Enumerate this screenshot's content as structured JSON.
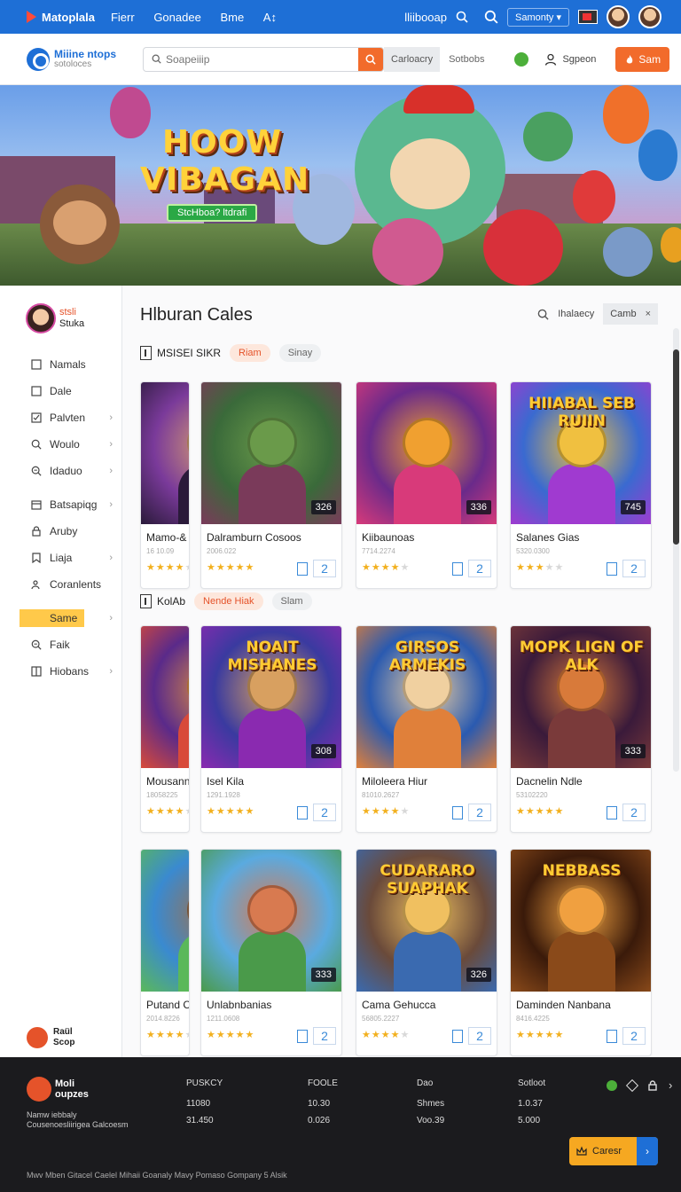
{
  "topbar": {
    "brand": "Matoplala",
    "nav": [
      "Fierr",
      "Gonadee",
      "Bme",
      "A↕"
    ],
    "account_text": "lliibooap",
    "pill_label": "Samonty"
  },
  "header": {
    "logo_line1": "Miiine ntops",
    "logo_line2": "sotoloces",
    "search_placeholder": "Soapeiiip",
    "category_button": "Carloacry",
    "link_1": "Sotbobs",
    "signin_label": "Sgpeon",
    "start_label": "Sam"
  },
  "hero": {
    "title_line1": "HOOW",
    "title_line2": "VIBAGAN",
    "cta_label": "StcHboa? ltdrafi"
  },
  "sidebar": {
    "user_name": "stsli",
    "user_sub": "Stuka",
    "items": [
      {
        "label": "Namals",
        "icon": "square-icon",
        "chevron": false
      },
      {
        "label": "Dale",
        "icon": "square-icon",
        "chevron": false
      },
      {
        "label": "Palvten",
        "icon": "check-square-icon",
        "chevron": true
      },
      {
        "label": "Woulo",
        "icon": "search-icon",
        "chevron": true
      },
      {
        "label": "Idaduo",
        "icon": "search-plus-icon",
        "chevron": true
      },
      {
        "label": "Batsapiqg",
        "icon": "calendar-icon",
        "chevron": true
      },
      {
        "label": "Aruby",
        "icon": "lock-icon",
        "chevron": false
      },
      {
        "label": "Liaja",
        "icon": "bookmark-icon",
        "chevron": true
      },
      {
        "label": "Coranlents",
        "icon": "people-icon",
        "chevron": false
      },
      {
        "label": "Same",
        "icon": "crown-icon",
        "chevron": true,
        "active": true
      },
      {
        "label": "Faik",
        "icon": "search-plus-icon",
        "chevron": false
      },
      {
        "label": "Hiobans",
        "icon": "columns-icon",
        "chevron": true
      }
    ],
    "footer_line1": "Raül",
    "footer_line2": "Scop"
  },
  "main": {
    "title": "Hlburan Cales",
    "search_label": "Ihalaecy",
    "chip_label": "Camb",
    "chip_close": "×",
    "section1": {
      "label": "MSISEI SIKR",
      "tag_on": "Riam",
      "tag_off": "Sinay"
    },
    "section2": {
      "label": "KolAb",
      "tag_on": "Nende Hiak",
      "tag_off": "Slam"
    },
    "cards": [
      {
        "title": "Mamo-&",
        "sub": "16 10.09",
        "count": "",
        "stars": 4,
        "num": "2",
        "theme": "a",
        "image_text": ""
      },
      {
        "title": "Dalramburn Cosoos",
        "sub": "2006.022",
        "count": "326",
        "stars": 5,
        "num": "2",
        "theme": "b",
        "image_text": ""
      },
      {
        "title": "Kiibaunoas",
        "sub": "7714.2274",
        "count": "336",
        "stars": 4,
        "num": "2",
        "theme": "c",
        "image_text": ""
      },
      {
        "title": "Salanes Gias",
        "sub": "5320.0300",
        "count": "745",
        "stars": 3,
        "num": "2",
        "theme": "d",
        "image_text": "HIIABAL SEB RUIIN"
      },
      {
        "title": "Mousann",
        "sub": "18058225",
        "count": "",
        "stars": 4,
        "num": "2",
        "theme": "e",
        "image_text": ""
      },
      {
        "title": "Isel Kila",
        "sub": "1291.1928",
        "count": "308",
        "stars": 5,
        "num": "2",
        "theme": "f",
        "image_text": "NOAIT MISHANES"
      },
      {
        "title": "Miloleera Hiur",
        "sub": "81010.2627",
        "count": "",
        "stars": 4,
        "num": "2",
        "theme": "g",
        "image_text": "GIRSOS ARMEKIS"
      },
      {
        "title": "Dacnelin Ndle",
        "sub": "53102220",
        "count": "333",
        "stars": 5,
        "num": "2",
        "theme": "h",
        "image_text": "MOPK LIGN OF ALK"
      },
      {
        "title": "Putand C",
        "sub": "2014.8226",
        "count": "",
        "stars": 4,
        "num": "2",
        "theme": "i",
        "image_text": ""
      },
      {
        "title": "Unlabnbanias",
        "sub": "1211.0608",
        "count": "333",
        "stars": 5,
        "num": "2",
        "theme": "j",
        "image_text": ""
      },
      {
        "title": "Cama Gehucca",
        "sub": "56805.2227",
        "count": "326",
        "stars": 4,
        "num": "2",
        "theme": "k",
        "image_text": "CUDARARO SUAPHAK"
      },
      {
        "title": "Daminden Nanbana",
        "sub": "8416.4225",
        "count": "",
        "stars": 5,
        "num": "2",
        "theme": "l",
        "image_text": "NEBBASS"
      }
    ]
  },
  "footer": {
    "logo_line1": "Moli",
    "logo_line2": "oupzes",
    "desc_line1": "Namw iebbaly",
    "desc_line2": "Cousenoesliirigea Galcoesm",
    "columns": [
      {
        "head": "PUSKCY",
        "v1": "11080",
        "v2": "31.450"
      },
      {
        "head": "FOOLE",
        "v1": "10.30",
        "v2": "0.026"
      },
      {
        "head": "Dao",
        "v1": "Shmes",
        "v2": "Voo.39"
      },
      {
        "head": "Sotloot",
        "v1": "1.0.37",
        "v2": "5.000"
      }
    ],
    "careers_label": "Caresr",
    "copyright": "Mwv Mben Gitacel Caelel Mihaii Goanaly Mavy Pomaso Gompany 5 Alsik"
  },
  "colors": {
    "topbar": "#1e6fd6",
    "accent_orange": "#f26b2b",
    "sidebar_active": "#ffc94a",
    "footer_bg": "#1b1b1e",
    "careers": "#f6a821"
  }
}
